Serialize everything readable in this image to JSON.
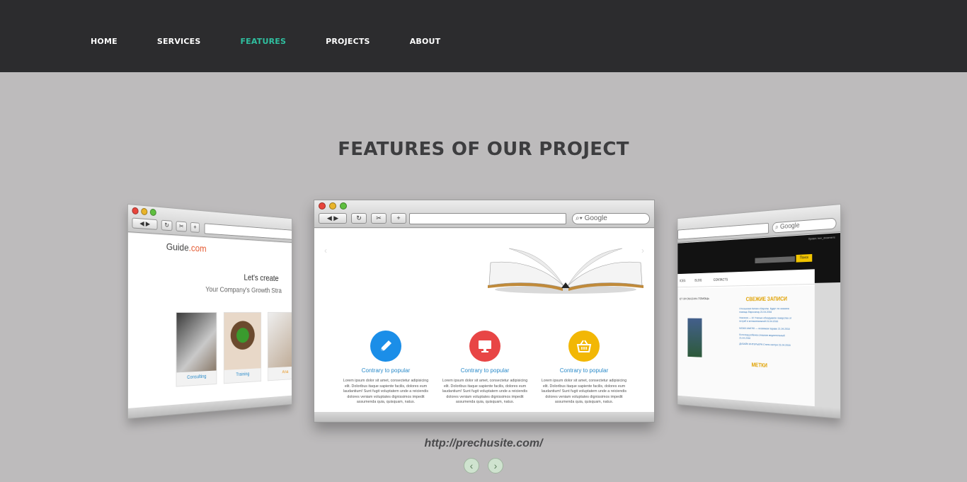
{
  "nav": {
    "items": [
      {
        "label": "HOME",
        "active": false
      },
      {
        "label": "SERVICES",
        "active": false
      },
      {
        "label": "FEATURES",
        "active": true
      },
      {
        "label": "PROJECTS",
        "active": false
      },
      {
        "label": "ABOUT",
        "active": false
      }
    ]
  },
  "section": {
    "title": "FEATURES OF OUR PROJECT",
    "caption": "http://prechusite.com/"
  },
  "colors": {
    "topbar": "#2c2c2e",
    "background": "#bdbbbc",
    "accent": "#2fc0a0"
  },
  "carousel": {
    "left": {
      "logo_main": "Guide",
      "logo_tld": ".com",
      "headline": "Let's create",
      "subline": "Your Company's Growth Stra",
      "thumbs": [
        "Consulting",
        "Training",
        "Ana"
      ]
    },
    "center": {
      "search_placeholder": "Google",
      "features": [
        {
          "icon": "pencil-icon",
          "color": "#1b8ee8",
          "title": "Contrary to popular",
          "text": "Lorem ipsum dolor sit amet, consectetur adipisicing elit. Doloribus itaque sapiente facilis, dolores eum laudantium! Sunt fugit voluptatem unde a reiciendis dolores veniam voluptates dignissimos impedit assumenda quia, quisquam, natus."
        },
        {
          "icon": "monitor-icon",
          "color": "#e84545",
          "title": "Contrary to popular",
          "text": "Lorem ipsum dolor sit amet, consectetur adipisicing elit. Doloribus itaque sapiente facilis, dolores eum laudantium! Sunt fugit voluptatem unde a reiciendis dolores veniam voluptates dignissimos impedit assumenda quia, quisquam, natus."
        },
        {
          "icon": "basket-icon",
          "color": "#f2b705",
          "title": "Contrary to popular",
          "text": "Lorem ipsum dolor sit amet, consectetur adipisicing elit. Doloribus itaque sapiente facilis, dolores eum laudantium! Sunt fugit voluptatem unde a reiciendis dolores veniam voluptates dignissimos impedit assumenda quia, quisquam, natus."
        }
      ]
    },
    "right": {
      "search_placeholder": "Google",
      "user_text": "Привет, ben_dreamerrs",
      "search_button": "Поиск",
      "menu": [
        "ICES",
        "BLOG",
        "CONTACTS"
      ],
      "post_title": "ЕТ ЛИ ОКАЗАНА ПОМОЩЬ",
      "sidebar_title": "СВЕЖИЕ ЗАПИСИ",
      "sidebar_links": [
        "Отношения Китая и Европы. Будет ли оказана помощь Евросоюзу 21.04.2016",
        "Никонов — 10 Ученые обнаружили лекарство от ястреб и антисигнальной 21.04.2016",
        "КАЗАХ-МАГЛО — несвяжем параве 21.04.2016",
        "Если вод ребенка слишком медлительный 21.04.2016",
        "ДИЗАЙН ИНТЕРЬЕРА Стиль кантри 21.04.2016"
      ],
      "sidebar_title2": "МЕТКИ"
    }
  }
}
